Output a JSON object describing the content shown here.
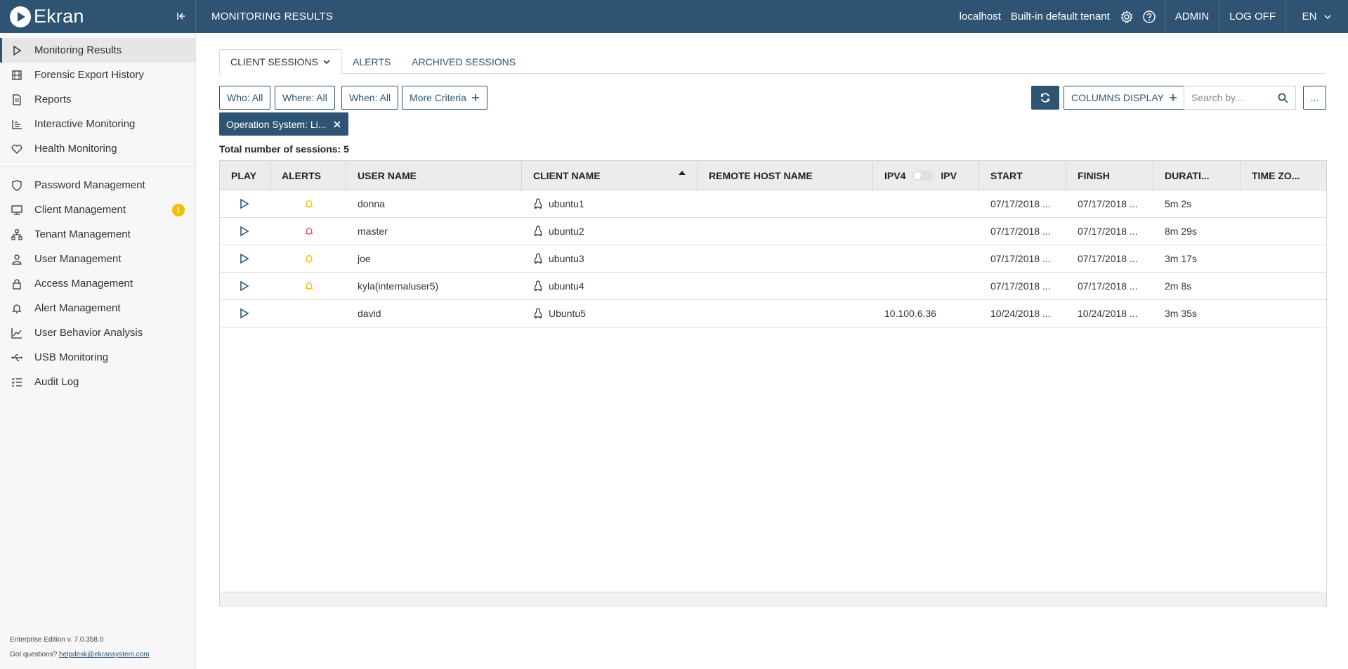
{
  "app": {
    "brand": "Ekran",
    "page_title": "MONITORING RESULTS",
    "host": "localhost",
    "tenant": "Built-in default tenant",
    "user": "ADMIN",
    "logoff": "LOG OFF",
    "lang": "EN"
  },
  "sidebar": {
    "items": [
      {
        "label": "Monitoring Results",
        "icon": "play-icon"
      },
      {
        "label": "Forensic Export History",
        "icon": "film-icon"
      },
      {
        "label": "Reports",
        "icon": "document-icon"
      },
      {
        "label": "Interactive Monitoring",
        "icon": "bar-chart-icon"
      },
      {
        "label": "Health Monitoring",
        "icon": "heart-icon"
      },
      {
        "label": "Password Management",
        "icon": "shield-icon"
      },
      {
        "label": "Client Management",
        "icon": "monitor-icon",
        "badge": "!"
      },
      {
        "label": "Tenant Management",
        "icon": "hierarchy-icon"
      },
      {
        "label": "User Management",
        "icon": "user-icon"
      },
      {
        "label": "Access Management",
        "icon": "lock-icon"
      },
      {
        "label": "Alert Management",
        "icon": "bell-icon"
      },
      {
        "label": "User Behavior Analysis",
        "icon": "trend-icon"
      },
      {
        "label": "USB Monitoring",
        "icon": "usb-icon"
      },
      {
        "label": "Audit Log",
        "icon": "checklist-icon"
      }
    ],
    "footer": {
      "edition": "Enterprise Edition v. 7.0.358.0",
      "questions": "Got questions?",
      "email": "helpdesk@ekransystem.com"
    }
  },
  "tabs": [
    "CLIENT SESSIONS",
    "ALERTS",
    "ARCHIVED SESSIONS"
  ],
  "filters": {
    "who": "Who: All",
    "where": "Where: All",
    "when": "When: All",
    "more": "More Criteria",
    "columns": "COLUMNS DISPLAY",
    "search_placeholder": "Search by...",
    "more_menu": "...",
    "chip": "Operation System: Li..."
  },
  "summary": "Total number of sessions: 5",
  "table": {
    "headers": [
      "PLAY",
      "ALERTS",
      "USER NAME",
      "CLIENT NAME",
      "REMOTE HOST NAME",
      "IPV4",
      "IPV",
      "START",
      "FINISH",
      "DURATI...",
      "TIME ZO..."
    ],
    "rows": [
      {
        "alert": "yellow",
        "user": "donna",
        "client": "ubuntu1",
        "remote": "",
        "ip": "",
        "start": "07/17/2018 ...",
        "finish": "07/17/2018 ...",
        "duration": "5m 2s",
        "tz": ""
      },
      {
        "alert": "red",
        "user": "master",
        "client": "ubuntu2",
        "remote": "",
        "ip": "",
        "start": "07/17/2018 ...",
        "finish": "07/17/2018 ...",
        "duration": "8m 29s",
        "tz": ""
      },
      {
        "alert": "yellow",
        "user": "joe",
        "client": "ubuntu3",
        "remote": "",
        "ip": "",
        "start": "07/17/2018 ...",
        "finish": "07/17/2018 ...",
        "duration": "3m 17s",
        "tz": ""
      },
      {
        "alert": "yellow",
        "user": "kyla(internaluser5)",
        "client": "ubuntu4",
        "remote": "",
        "ip": "",
        "start": "07/17/2018 ...",
        "finish": "07/17/2018 ...",
        "duration": "2m 8s",
        "tz": ""
      },
      {
        "alert": "none",
        "user": "david",
        "client": "Ubuntu5",
        "remote": "",
        "ip": "10.100.6.36",
        "start": "10/24/2018 ...",
        "finish": "10/24/2018 ...",
        "duration": "3m 35s",
        "tz": ""
      }
    ]
  },
  "colors": {
    "primary": "#2f5473",
    "alert_yellow": "#f2c200",
    "alert_red": "#e05a5a",
    "badge": "#f5c000"
  }
}
